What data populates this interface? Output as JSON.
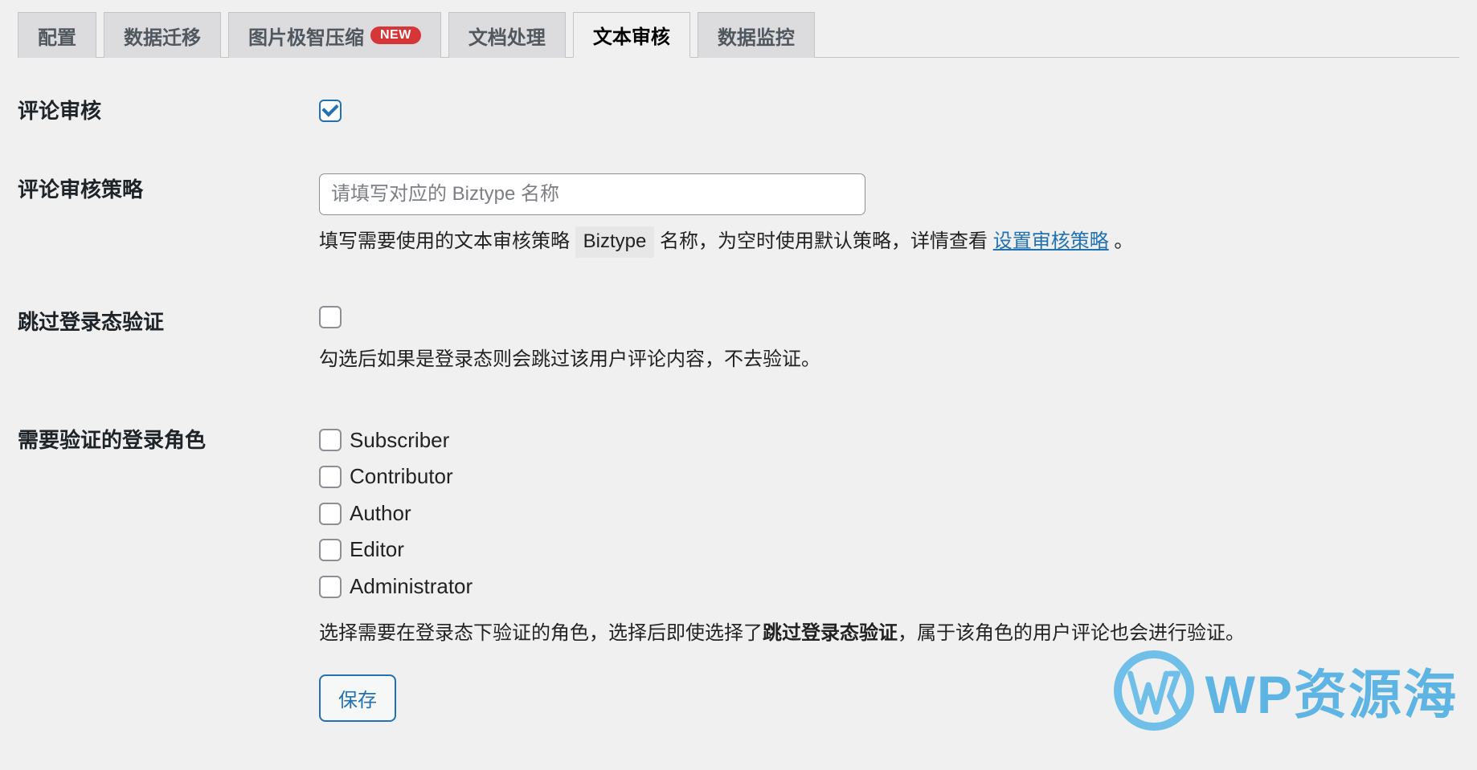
{
  "tabs": [
    {
      "label": "配置",
      "active": false,
      "name": "tab-config"
    },
    {
      "label": "数据迁移",
      "active": false,
      "name": "tab-migrate"
    },
    {
      "label": "图片极智压缩",
      "active": false,
      "badge": "NEW",
      "name": "tab-compress"
    },
    {
      "label": "文档处理",
      "active": false,
      "name": "tab-doc"
    },
    {
      "label": "文本审核",
      "active": true,
      "name": "tab-text-audit"
    },
    {
      "label": "数据监控",
      "active": false,
      "name": "tab-monitor"
    }
  ],
  "form": {
    "comment_audit": {
      "label": "评论审核",
      "checked": true
    },
    "comment_policy": {
      "label": "评论审核策略",
      "placeholder": "请填写对应的 Biztype 名称",
      "value": "",
      "desc_pre": "填写需要使用的文本审核策略 ",
      "desc_code": "Biztype",
      "desc_mid": " 名称，为空时使用默认策略，详情查看 ",
      "desc_link": "设置审核策略",
      "desc_post": "。"
    },
    "skip_login": {
      "label": "跳过登录态验证",
      "checked": false,
      "desc": "勾选后如果是登录态则会跳过该用户评论内容，不去验证。"
    },
    "roles": {
      "label": "需要验证的登录角色",
      "items": [
        {
          "label": "Subscriber",
          "checked": false
        },
        {
          "label": "Contributor",
          "checked": false
        },
        {
          "label": "Author",
          "checked": false
        },
        {
          "label": "Editor",
          "checked": false
        },
        {
          "label": "Administrator",
          "checked": false
        }
      ],
      "desc_pre": "选择需要在登录态下验证的角色，选择后即使选择了",
      "desc_bold": "跳过登录态验证",
      "desc_post": "，属于该角色的用户评论也会进行验证。"
    },
    "save_label": "保存"
  },
  "watermark": {
    "text": "WP资源海"
  }
}
